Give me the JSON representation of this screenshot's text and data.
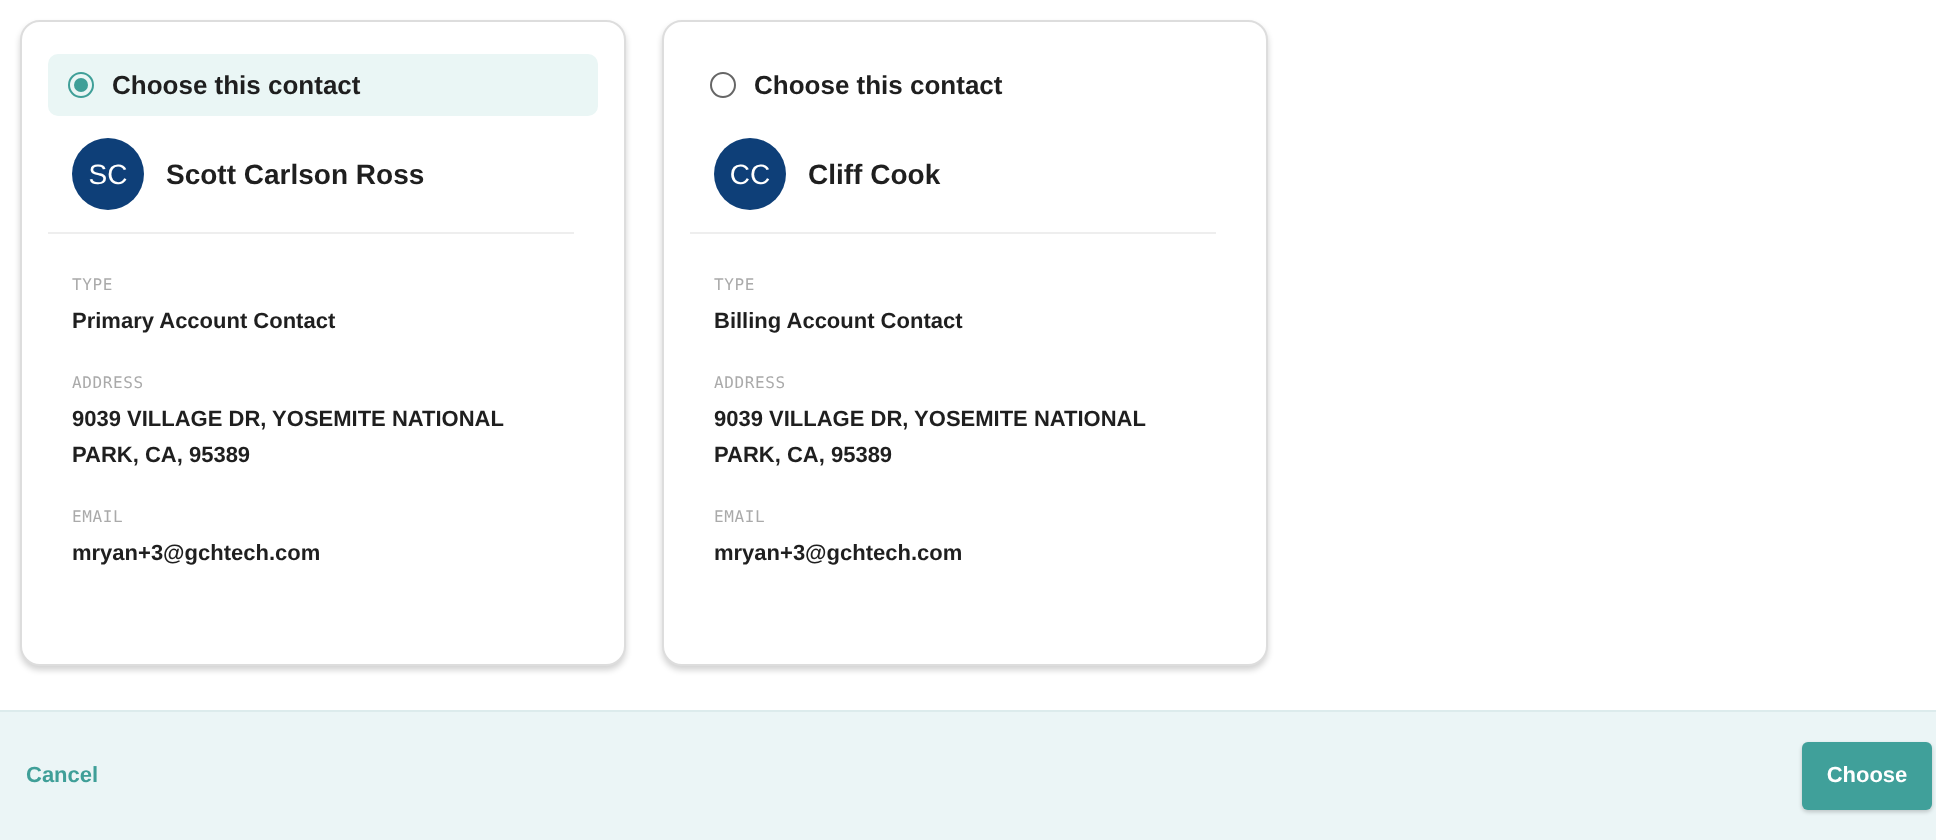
{
  "contacts": [
    {
      "radio_label": "Choose this contact",
      "selected": true,
      "initials": "SC",
      "name": "Scott Carlson Ross",
      "fields": [
        {
          "label": "TYPE",
          "value": "Primary Account Contact"
        },
        {
          "label": "ADDRESS",
          "value": "9039 VILLAGE DR, YOSEMITE NATIONAL PARK, CA, 95389"
        },
        {
          "label": "EMAIL",
          "value": "mryan+3@gchtech.com"
        }
      ]
    },
    {
      "radio_label": "Choose this contact",
      "selected": false,
      "initials": "CC",
      "name": "Cliff Cook",
      "fields": [
        {
          "label": "TYPE",
          "value": "Billing Account Contact"
        },
        {
          "label": "ADDRESS",
          "value": "9039 VILLAGE DR, YOSEMITE NATIONAL PARK, CA, 95389"
        },
        {
          "label": "EMAIL",
          "value": "mryan+3@gchtech.com"
        }
      ]
    }
  ],
  "footer": {
    "cancel": "Cancel",
    "choose": "Choose"
  }
}
